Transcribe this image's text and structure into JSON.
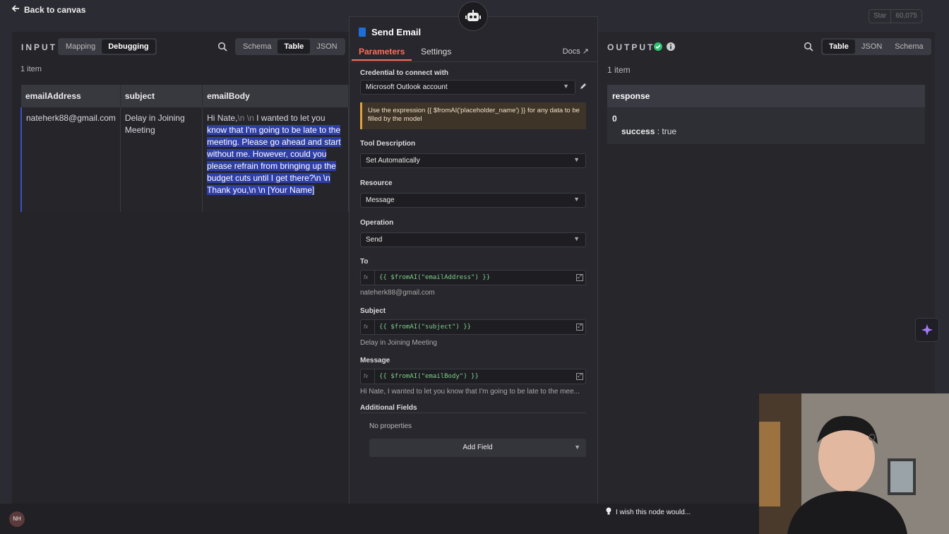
{
  "topbar": {
    "back_label": "Back to canvas",
    "github_star": "Star",
    "github_count": "60,075"
  },
  "input": {
    "label": "INPUT",
    "modes": [
      "Mapping",
      "Debugging"
    ],
    "active_mode": "Debugging",
    "views": [
      "Schema",
      "Table",
      "JSON"
    ],
    "active_view": "Table",
    "item_count": "1 item",
    "columns": [
      "emailAddress",
      "subject",
      "emailBody"
    ],
    "row": {
      "emailAddress": "nateherk88@gmail.com",
      "subject": "Delay in Joining Meeting",
      "emailBody_plain": "Hi Nate,",
      "emailBody_escape": "\\n \\n",
      "emailBody_pre": " I wanted to let you",
      "emailBody_selected": "know that I'm going to be late to the meeting. Please go ahead and start without me. However, could you please refrain from bringing up the budget cuts until I get there?\\n \\n Thank you,\\n \\n [Your Name]"
    }
  },
  "node": {
    "title": "Send Email",
    "tabs": [
      "Parameters",
      "Settings"
    ],
    "active_tab": "Parameters",
    "docs_label": "Docs",
    "credential_label": "Credential to connect with",
    "credential_value": "Microsoft Outlook account",
    "notice": "Use the expression {{ $fromAI('placeholder_name') }} for any data to be filled by the model",
    "tool_description_label": "Tool Description",
    "tool_description_value": "Set Automatically",
    "resource_label": "Resource",
    "resource_value": "Message",
    "operation_label": "Operation",
    "operation_value": "Send",
    "to_label": "To",
    "to_expr": "{{ $fromAI(\"emailAddress\") }}",
    "to_hint": "nateherk88@gmail.com",
    "subject_label": "Subject",
    "subject_expr": "{{ $fromAI(\"subject\") }}",
    "subject_hint": "Delay in Joining Meeting",
    "message_label": "Message",
    "message_expr": "{{ $fromAI(\"emailBody\") }}",
    "message_hint": "Hi Nate, I wanted to let you know that I'm going to be late to the mee...",
    "additional_label": "Additional Fields",
    "no_properties": "No properties",
    "add_field": "Add Field",
    "fx_label": "fx"
  },
  "output": {
    "label": "OUTPUT",
    "views": [
      "Table",
      "JSON",
      "Schema"
    ],
    "active_view": "Table",
    "item_count": "1 item",
    "column": "response",
    "index": "0",
    "key": "success",
    "value": "true"
  },
  "footer": {
    "avatar": "NH",
    "wish": "I wish this node would..."
  },
  "colors": {
    "accent": "#ff6d5a",
    "success": "#2fbf71",
    "selection": "#2f3fa8",
    "warning_border": "#e0a33b"
  }
}
